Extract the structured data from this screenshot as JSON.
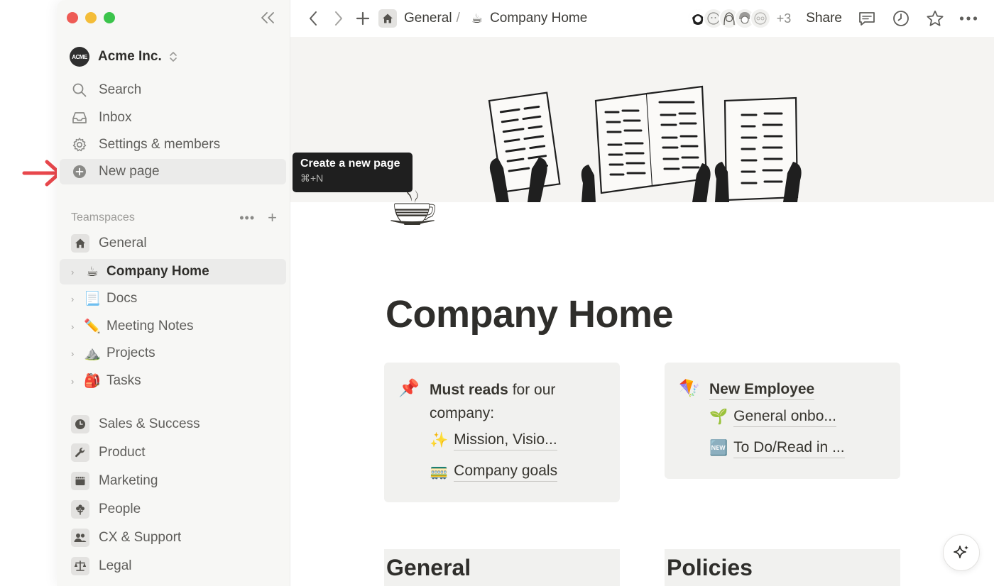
{
  "workspace": {
    "name": "Acme Inc.",
    "logo_text": "ACME"
  },
  "sidebar": {
    "nav": [
      {
        "label": "Search",
        "icon": "search-icon"
      },
      {
        "label": "Inbox",
        "icon": "inbox-icon"
      },
      {
        "label": "Settings & members",
        "icon": "gear-icon"
      },
      {
        "label": "New page",
        "icon": "plus-circle-icon"
      }
    ],
    "teamspaces_label": "Teamspaces",
    "pages": [
      {
        "label": "General",
        "icon": "home-icon"
      },
      {
        "label": "Company Home",
        "emoji": "☕"
      },
      {
        "label": "Docs",
        "emoji": "📃"
      },
      {
        "label": "Meeting Notes",
        "emoji": "✏️"
      },
      {
        "label": "Projects",
        "emoji": "⛰️"
      },
      {
        "label": "Tasks",
        "emoji": "🎒"
      }
    ],
    "teams": [
      {
        "label": "Sales & Success",
        "icon": "clock-icon"
      },
      {
        "label": "Product",
        "icon": "wrench-icon"
      },
      {
        "label": "Marketing",
        "icon": "film-icon"
      },
      {
        "label": "People",
        "icon": "flower-icon"
      },
      {
        "label": "CX & Support",
        "icon": "people-icon"
      },
      {
        "label": "Legal",
        "icon": "scale-icon"
      }
    ]
  },
  "tooltip": {
    "title": "Create a new page",
    "shortcut": "⌘+N"
  },
  "topbar": {
    "breadcrumb_root": "General",
    "breadcrumb_sep": "/",
    "breadcrumb_page_emoji": "☕",
    "breadcrumb_page": "Company Home",
    "extra_avatars": "+3",
    "share_label": "Share"
  },
  "page": {
    "icon_emoji": "☕",
    "title": "Company Home",
    "callout_left": {
      "emoji": "📌",
      "bold": "Must reads",
      "rest": " for our company:",
      "links": [
        {
          "emoji": "✨",
          "label": "Mission, Visio..."
        },
        {
          "emoji": "🚃",
          "label": "Company goals"
        }
      ]
    },
    "callout_right": {
      "emoji": "🪁",
      "heading": "New Employee",
      "links": [
        {
          "emoji": "🌱",
          "label": "General onbo..."
        },
        {
          "emoji": "🆕",
          "label": "To Do/Read in ..."
        }
      ]
    },
    "sections": [
      "General",
      "Policies"
    ]
  },
  "colors": {
    "accent_red": "#e8474c",
    "sidebar_bg": "#f7f7f5",
    "tooltip_bg": "#1f1f1f"
  }
}
